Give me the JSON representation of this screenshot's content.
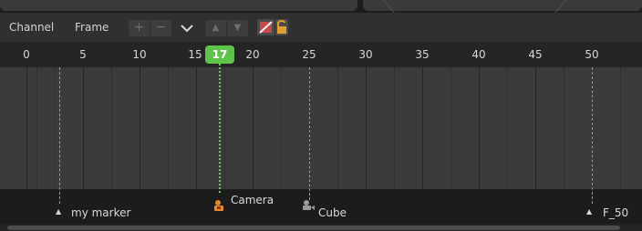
{
  "header": {
    "menu": [
      {
        "label": "Channel"
      },
      {
        "label": "Frame"
      }
    ],
    "buttons": {
      "add_symbol": "+",
      "remove_symbol": "−",
      "up_symbol": "▲",
      "down_symbol": "▼"
    },
    "icons": [
      "plus-icon",
      "minus-icon",
      "chevron-down-icon",
      "arrow-up-icon",
      "arrow-down-icon",
      "camera-filter-icon",
      "lock-icon"
    ]
  },
  "timeline": {
    "ruler_labels": [
      "0",
      "5",
      "10",
      "15",
      "20",
      "25",
      "30",
      "35",
      "40",
      "45",
      "50"
    ],
    "current_frame": "17"
  },
  "markers": [
    {
      "name": "my marker",
      "frame": 3,
      "icon": "marker-triangle-icon"
    },
    {
      "name": "Camera",
      "frame": 17,
      "icon": "camera-icon"
    },
    {
      "name": "Cube",
      "frame": 25,
      "icon": "cube-camera-icon"
    },
    {
      "name": "F_50",
      "frame": 50,
      "icon": "marker-triangle-icon"
    }
  ],
  "colors": {
    "playhead": "#5fc24b",
    "camera_icon": "#e8882a",
    "background": "#3b3b3b",
    "header": "#303030"
  }
}
